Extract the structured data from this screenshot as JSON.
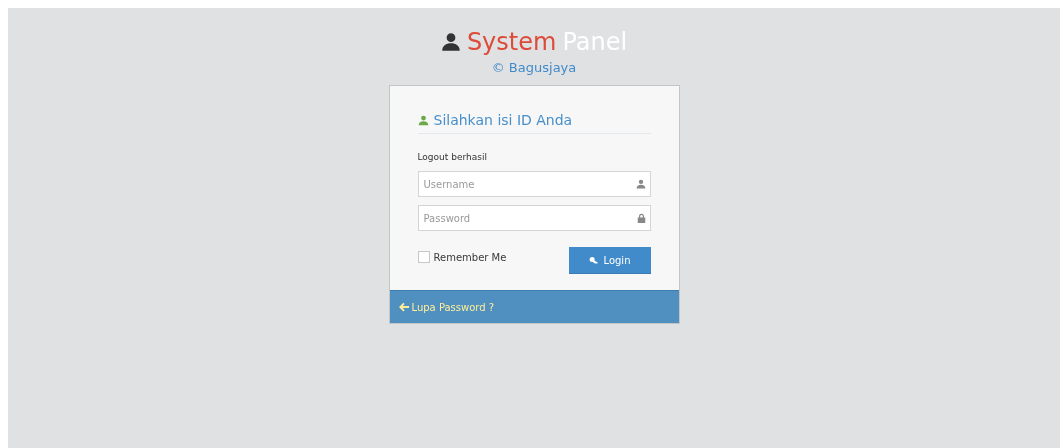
{
  "brand": {
    "title_first": "System",
    "title_second": "Panel",
    "subtitle": "© Bagusjaya"
  },
  "login_box": {
    "heading": "Silahkan isi ID Anda",
    "message": "Logout berhasil",
    "fields": [
      {
        "kind": "username",
        "placeholder": "Username"
      },
      {
        "kind": "password",
        "placeholder": "Password"
      }
    ],
    "remember": {
      "label": "Remember Me",
      "checked": false
    },
    "submit": "Login",
    "footer_link": "Lupa Password ?"
  }
}
